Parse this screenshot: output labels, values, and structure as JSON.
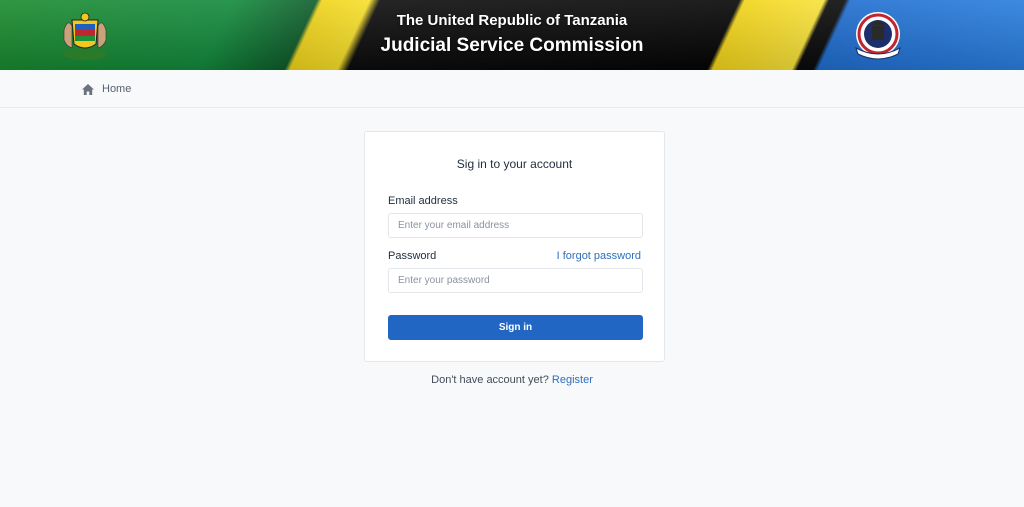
{
  "header": {
    "title_line1": "The United Republic of Tanzania",
    "title_line2": "Judicial Service Commission",
    "left_emblem_icon": "coat-of-arms-icon",
    "right_emblem_icon": "commission-seal-icon"
  },
  "breadcrumb": {
    "home_icon": "home-icon",
    "home_label": "Home"
  },
  "login": {
    "title": "Sig in to your account",
    "email_label": "Email address",
    "email_placeholder": "Enter your email address",
    "password_label": "Password",
    "forgot_label": "I forgot password",
    "password_placeholder": "Enter your password",
    "submit_label": "Sign in"
  },
  "register": {
    "prompt": "Don't have account yet?",
    "link_label": "Register"
  },
  "colors": {
    "primary": "#2266c3",
    "link": "#2f6fbf",
    "page_bg": "#f8f9fb"
  }
}
